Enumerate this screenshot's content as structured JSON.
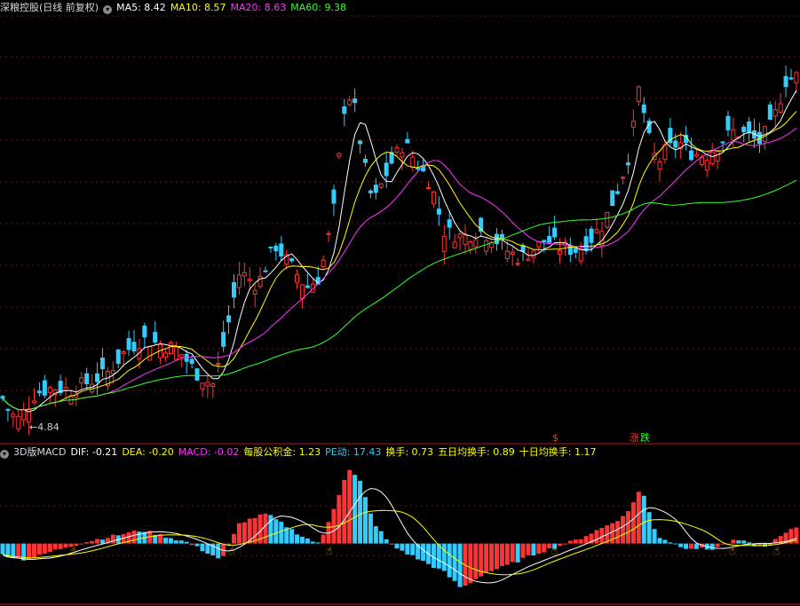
{
  "main_panel": {
    "title": "深粮控股(日线 前复权)",
    "ma": [
      {
        "label": "MA5:",
        "value": "8.42",
        "color": "#ffffff"
      },
      {
        "label": "MA10:",
        "value": "8.57",
        "color": "#ffff00"
      },
      {
        "label": "MA20:",
        "value": "8.63",
        "color": "#ff33ff"
      },
      {
        "label": "MA60:",
        "value": "9.38",
        "color": "#33ff33"
      }
    ],
    "low_marker": "4.84",
    "event_marks": {
      "dividend": "$",
      "limit_up": "涨",
      "limit_down": "跌"
    }
  },
  "indicator_panel": {
    "title": "3D版MACD",
    "fields": [
      {
        "label": "DIF:",
        "value": "-0.21",
        "color": "#ffffff"
      },
      {
        "label": "DEA:",
        "value": "-0.20",
        "color": "#ffff00"
      },
      {
        "label": "MACD:",
        "value": "-0.02",
        "color": "#ff33ff"
      },
      {
        "label": "每股公积金:",
        "value": "1.23",
        "color": "#ffff00"
      },
      {
        "label": "PE动:",
        "value": "17.43",
        "color": "#33ccff"
      },
      {
        "label": "换手:",
        "value": "0.73",
        "color": "#ffff00"
      },
      {
        "label": "五日均换手:",
        "value": "0.89",
        "color": "#ffff00"
      },
      {
        "label": "十日均换手:",
        "value": "1.17",
        "color": "#ffff00"
      }
    ]
  },
  "colors": {
    "up": "#ff3333",
    "down": "#33ccff",
    "ma5": "#ffffff",
    "ma10": "#ffff00",
    "ma20": "#ff33ff",
    "ma60": "#33ff33",
    "grid": "#7a1010"
  },
  "chart_data": {
    "type": "candlestick",
    "price_range": [
      4.5,
      20
    ],
    "anchors": [
      [
        0,
        6.0
      ],
      [
        12,
        5.2
      ],
      [
        22,
        5.0
      ],
      [
        40,
        6.0
      ],
      [
        60,
        6.2
      ],
      [
        80,
        6.1
      ],
      [
        100,
        6.4
      ],
      [
        120,
        6.7
      ],
      [
        140,
        7.5
      ],
      [
        160,
        8.0
      ],
      [
        180,
        7.8
      ],
      [
        200,
        7.6
      ],
      [
        215,
        7.0
      ],
      [
        225,
        6.6
      ],
      [
        240,
        6.3
      ],
      [
        250,
        7.5
      ],
      [
        270,
        10.5
      ],
      [
        290,
        10.0
      ],
      [
        310,
        11.5
      ],
      [
        330,
        10.6
      ],
      [
        345,
        9.9
      ],
      [
        360,
        10.3
      ],
      [
        375,
        12.5
      ],
      [
        390,
        17.3
      ],
      [
        400,
        16.5
      ],
      [
        410,
        14.5
      ],
      [
        420,
        13.0
      ],
      [
        440,
        14.5
      ],
      [
        455,
        15.3
      ],
      [
        470,
        14.5
      ],
      [
        485,
        13.8
      ],
      [
        500,
        12.0
      ],
      [
        520,
        11.8
      ],
      [
        540,
        12.0
      ],
      [
        555,
        11.8
      ],
      [
        570,
        11.3
      ],
      [
        585,
        11.0
      ],
      [
        600,
        11.3
      ],
      [
        615,
        11.7
      ],
      [
        630,
        11.4
      ],
      [
        650,
        11.3
      ],
      [
        665,
        11.7
      ],
      [
        680,
        12.3
      ],
      [
        695,
        13.5
      ],
      [
        710,
        15.0
      ],
      [
        720,
        17.4
      ],
      [
        730,
        15.5
      ],
      [
        740,
        14.5
      ],
      [
        750,
        15.0
      ],
      [
        765,
        15.3
      ],
      [
        780,
        14.9
      ],
      [
        795,
        14.8
      ],
      [
        810,
        15.3
      ],
      [
        825,
        15.7
      ],
      [
        840,
        15.6
      ],
      [
        855,
        15.3
      ],
      [
        870,
        16.0
      ],
      [
        885,
        17.6
      ],
      [
        901,
        17.8
      ]
    ],
    "macd_range": [
      -0.8,
      1.1
    ],
    "macd_anchors": [
      [
        0,
        -0.14
      ],
      [
        30,
        -0.22
      ],
      [
        70,
        -0.06
      ],
      [
        110,
        0.06
      ],
      [
        160,
        0.18
      ],
      [
        210,
        0.02
      ],
      [
        250,
        -0.22
      ],
      [
        270,
        0.28
      ],
      [
        300,
        0.4
      ],
      [
        340,
        0.1
      ],
      [
        360,
        -0.01
      ],
      [
        380,
        0.6
      ],
      [
        392,
        1.0
      ],
      [
        405,
        0.85
      ],
      [
        420,
        0.3
      ],
      [
        440,
        -0.02
      ],
      [
        470,
        -0.2
      ],
      [
        500,
        -0.38
      ],
      [
        520,
        -0.6
      ],
      [
        545,
        -0.4
      ],
      [
        570,
        -0.3
      ],
      [
        600,
        -0.15
      ],
      [
        625,
        -0.05
      ],
      [
        650,
        0.05
      ],
      [
        680,
        0.22
      ],
      [
        705,
        0.38
      ],
      [
        722,
        0.75
      ],
      [
        740,
        0.1
      ],
      [
        770,
        -0.05
      ],
      [
        800,
        -0.08
      ],
      [
        830,
        0.05
      ],
      [
        860,
        -0.06
      ],
      [
        880,
        0.1
      ],
      [
        901,
        0.25
      ]
    ]
  }
}
